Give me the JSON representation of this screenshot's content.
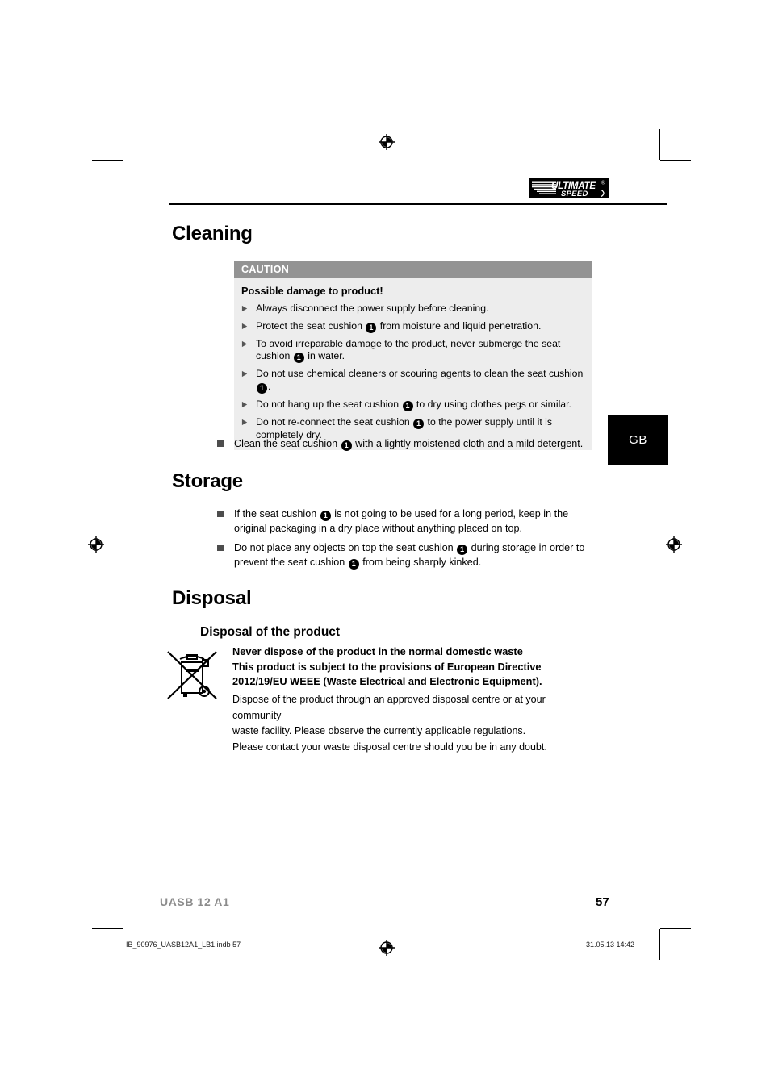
{
  "document": {
    "brand_logo": "ultimate-speed-logo",
    "language_tab": "GB",
    "page_number": "57",
    "model": "UASB 12 A1",
    "footer_file": "IB_90976_UASB12A1_LB1.indb   57",
    "footer_date": "31.05.13   14:42"
  },
  "cleaning": {
    "heading": "Cleaning",
    "caution": {
      "label": "CAUTION",
      "title": "Possible damage to product!",
      "items": [
        {
          "pre": "Always disconnect the power supply before cleaning.",
          "ref": null,
          "post": ""
        },
        {
          "pre": "Protect the seat cushion ",
          "ref": "1",
          "post": " from moisture and liquid penetration."
        },
        {
          "pre": "To avoid irreparable damage to the product, never submerge the seat cushion ",
          "ref": "1",
          "post": " in water."
        },
        {
          "pre": "Do not use chemical cleaners or scouring agents to clean the seat cushion ",
          "ref": "1",
          "post": "."
        },
        {
          "pre": "Do not hang up the seat cushion ",
          "ref": "1",
          "post": " to dry using clothes pegs or similar."
        },
        {
          "pre": "Do not re-connect the seat cushion ",
          "ref": "1",
          "post": " to the power supply until it is completely dry."
        }
      ]
    },
    "bullet": {
      "pre": "Clean the seat cushion ",
      "ref": "1",
      "post": " with a lightly moistened cloth and a mild detergent."
    }
  },
  "storage": {
    "heading": "Storage",
    "bullets": [
      {
        "pre": "If the seat cushion ",
        "ref": "1",
        "post": " is not going to be used for a long period, keep in the original packaging in a dry place without anything placed on top."
      },
      {
        "pre": "Do not place any objects on top the seat cushion ",
        "ref": "1",
        "mid": " during storage in order to prevent the seat cushion ",
        "ref2": "1",
        "post": " from being sharply kinked."
      }
    ]
  },
  "disposal": {
    "heading": "Disposal",
    "subheading": "Disposal of the product",
    "icon": "crossed-out-wheelie-bin-icon",
    "bold_lines": [
      "Never dispose of the product in the normal domestic waste",
      "This product is subject to the provisions of European Directive",
      "2012/19/EU WEEE (Waste Electrical and Electronic Equipment)."
    ],
    "body_lines": [
      "Dispose of the product through an approved disposal centre or at your community",
      "waste facility. Please observe the currently applicable regulations.",
      "Please contact your waste disposal centre should you be in any doubt."
    ]
  },
  "colors": {
    "caution_header_bg": "#939393",
    "caution_body_bg": "#ededed",
    "bullet_square": "#4d4d4d",
    "model_text": "#8c8c8c",
    "tab_bg": "#000000"
  }
}
